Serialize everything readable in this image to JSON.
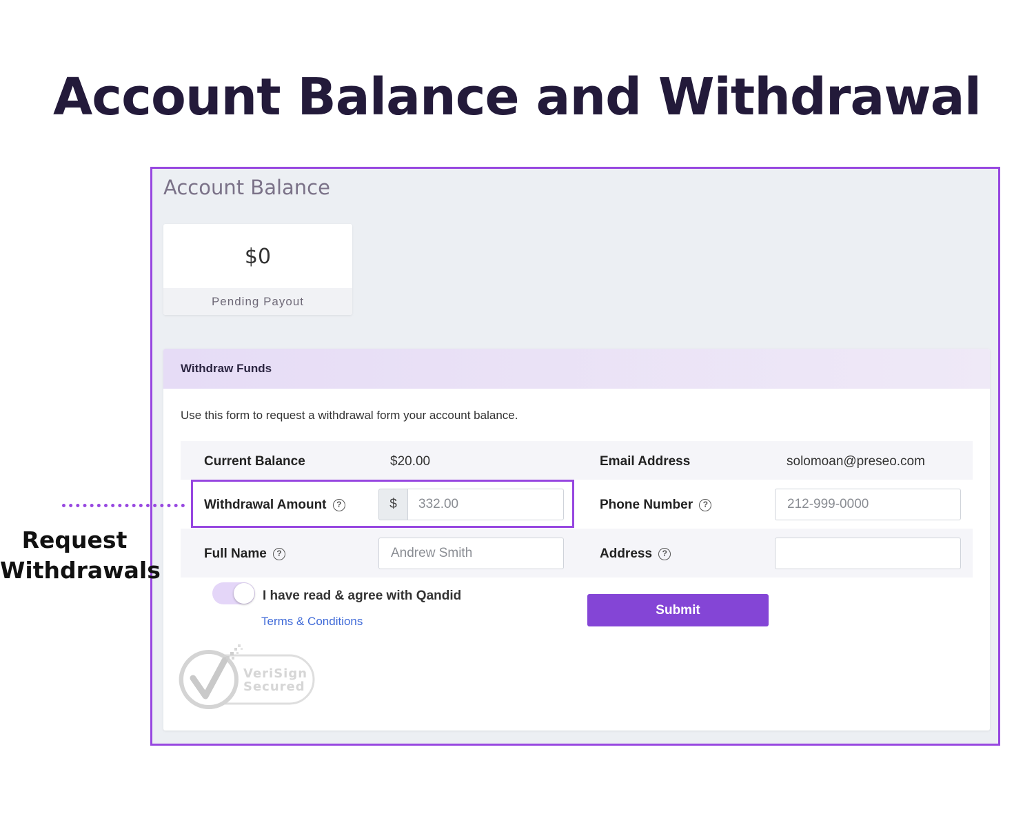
{
  "page": {
    "title": "Account Balance and Withdrawal"
  },
  "account_balance": {
    "heading": "Account Balance",
    "amount": "$0",
    "label": "Pending Payout"
  },
  "withdraw_form": {
    "title": "Withdraw Funds",
    "description": "Use this form to request a withdrawal form your account balance.",
    "current_balance_label": "Current Balance",
    "current_balance_value": "$20.00",
    "email_label": "Email Address",
    "email_value": "solomoan@preseo.com",
    "withdrawal_amount_label": "Withdrawal Amount",
    "currency_prefix": "$",
    "withdrawal_amount_placeholder": "332.00",
    "phone_label": "Phone Number",
    "phone_placeholder": "212-999-0000",
    "full_name_label": "Full Name",
    "full_name_placeholder": "Andrew Smith",
    "address_label": "Address",
    "address_value": "",
    "agree_text": "I have read & agree with Qandid",
    "agree_toggle_on": true,
    "terms_link": "Terms & Conditions",
    "submit_label": "Submit",
    "help_icon": "?"
  },
  "callout": {
    "line1": "Request",
    "line2": "Withdrawals"
  },
  "badge": {
    "icon": "verisign-check-icon",
    "line1": "VeriSign",
    "line2": "Secured"
  },
  "colors": {
    "accent": "#9747e0",
    "submit": "#8445d6",
    "title": "#231a3a",
    "header_band": "#e6dcf6",
    "link": "#3f6ad8"
  }
}
